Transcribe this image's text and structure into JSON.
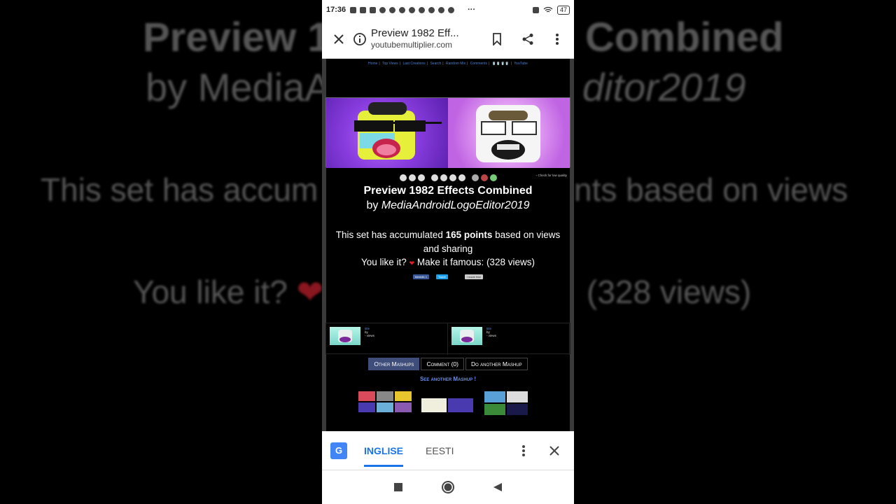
{
  "status_bar": {
    "time": "17:36",
    "battery": "47"
  },
  "url_bar": {
    "page_title": "Preview 1982 Eff...",
    "host": "youtubemultiplier.com"
  },
  "site_nav": {
    "links": [
      "Home",
      "Top Views",
      "Last Creations",
      "Search",
      "Random Mix",
      "Comments"
    ],
    "youtube": "YouTube"
  },
  "player": {
    "low_quality": "Check for low quality"
  },
  "mashup": {
    "title": "Preview 1982 Effects Combined",
    "by": "by",
    "author": "MediaAndroidLogoEditor2019",
    "desc_prefix": "This set has accumulated",
    "points": "165 points",
    "desc_suffix": "based on views and sharing",
    "like_prefix": "You like it?",
    "like_suffix": "Make it famous: (328 views)"
  },
  "share": {
    "facebook": "Meeldib 1",
    "twitter": "Tweet",
    "other": "I made this!"
  },
  "related": [
    {
      "title": "title",
      "by": "by",
      "views": "- views"
    },
    {
      "title": "title",
      "by": "by",
      "views": "- views"
    }
  ],
  "tabs": {
    "other": "Other Mashups",
    "comment": "Comment (0)",
    "another": "Do another Mashup"
  },
  "see_another": "See another Mashup !",
  "translate": {
    "lang_from": "INGLISE",
    "lang_to": "EESTI"
  },
  "colors": {
    "accent": "#1a73e8",
    "tab_active": "#3f4d7a",
    "link": "#4a7fd0"
  },
  "background_echo": {
    "line1a": "Preview 1",
    "line1b": "Combined",
    "line2a": "by MediaA",
    "line2b": "ditor2019",
    "line3a": "This set has accum",
    "line3b": "nts based on views",
    "line4a": "You like it?",
    "line4b": "(328 views)"
  }
}
